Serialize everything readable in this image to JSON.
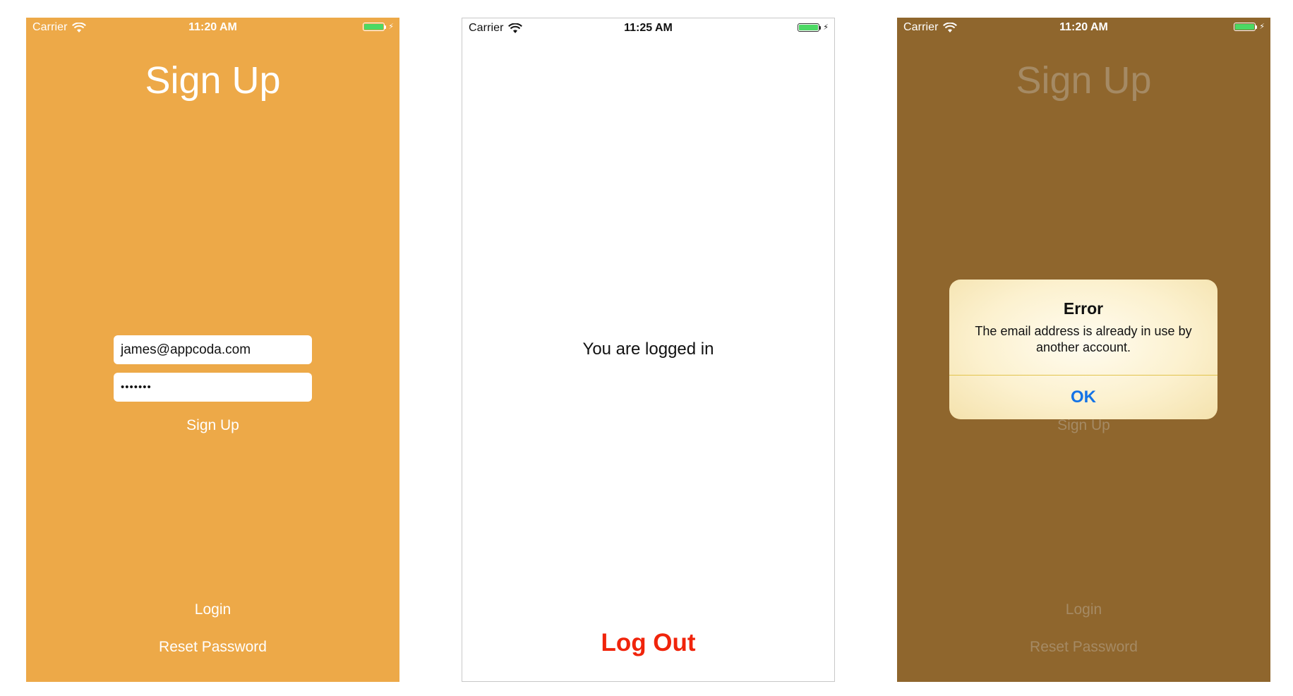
{
  "colors": {
    "signup_bg": "#eda948",
    "signup_bg_dimmed": "#8f662d",
    "white": "#ffffff",
    "dimmed_text": "#a58a64",
    "logout_red": "#f0240b",
    "alert_button_blue": "#1473e6",
    "battery_green": "#4cd964"
  },
  "screens": [
    {
      "status": {
        "carrier": "Carrier",
        "time": "11:20 AM"
      },
      "title": "Sign Up",
      "email_value": "james@appcoda.com",
      "password_value": "•••••••",
      "signup_label": "Sign Up",
      "login_label": "Login",
      "reset_label": "Reset Password"
    },
    {
      "status": {
        "carrier": "Carrier",
        "time": "11:25 AM"
      },
      "message": "You are logged in",
      "logout_label": "Log Out"
    },
    {
      "status": {
        "carrier": "Carrier",
        "time": "11:20 AM"
      },
      "title": "Sign Up",
      "signup_label": "Sign Up",
      "login_label": "Login",
      "reset_label": "Reset Password",
      "alert": {
        "title": "Error",
        "message": "The email address is already in use by another account.",
        "ok_label": "OK"
      }
    }
  ],
  "icons": {
    "wifi": "wifi-icon",
    "battery": "battery-icon",
    "charging": "charging-bolt-icon"
  }
}
